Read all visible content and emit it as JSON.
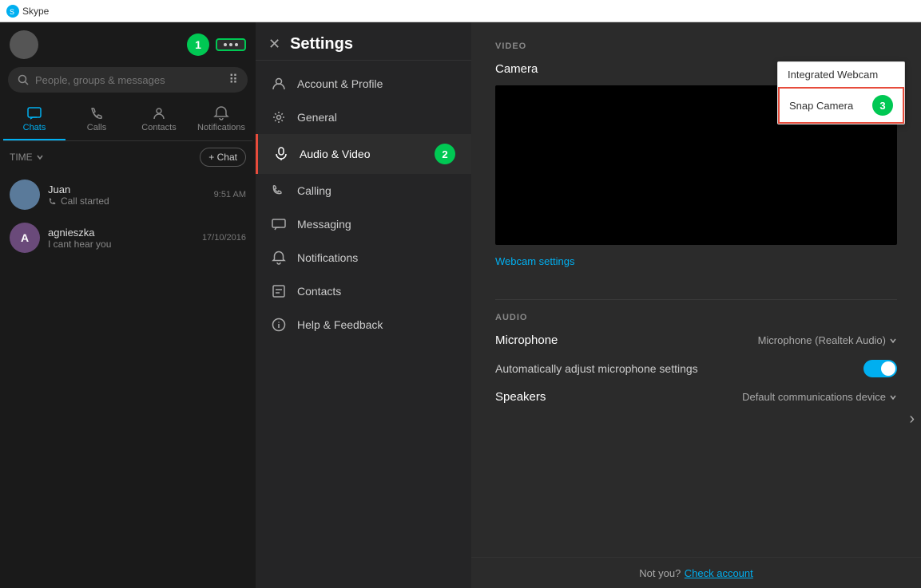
{
  "titleBar": {
    "appName": "Skype"
  },
  "sidebar": {
    "moreButtonLabel": "...",
    "searchPlaceholder": "People, groups & messages",
    "navTabs": [
      {
        "id": "chats",
        "label": "Chats",
        "active": true
      },
      {
        "id": "calls",
        "label": "Calls",
        "active": false
      },
      {
        "id": "contacts",
        "label": "Contacts",
        "active": false
      },
      {
        "id": "notifications",
        "label": "Notifications",
        "active": false
      }
    ],
    "timeLabel": "TIME",
    "newChatLabel": "+ Chat",
    "chatItems": [
      {
        "id": "juan",
        "name": "Juan",
        "preview": "Call started",
        "time": "9:51 AM",
        "hasCallIcon": true
      },
      {
        "id": "agnieszka",
        "name": "agnieszka",
        "preview": "I cant hear you",
        "time": "17/10/2016",
        "hasCallIcon": false
      }
    ],
    "stepBadge": "1"
  },
  "settingsPanel": {
    "title": "Settings",
    "menuItems": [
      {
        "id": "account",
        "label": "Account & Profile",
        "icon": "person"
      },
      {
        "id": "general",
        "label": "General",
        "icon": "gear"
      },
      {
        "id": "audio-video",
        "label": "Audio & Video",
        "icon": "mic",
        "active": true
      },
      {
        "id": "calling",
        "label": "Calling",
        "icon": "phone"
      },
      {
        "id": "messaging",
        "label": "Messaging",
        "icon": "message"
      },
      {
        "id": "notifications",
        "label": "Notifications",
        "icon": "bell"
      },
      {
        "id": "contacts",
        "label": "Contacts",
        "icon": "contacts"
      },
      {
        "id": "help",
        "label": "Help & Feedback",
        "icon": "info"
      }
    ],
    "stepBadge": "2"
  },
  "mainContent": {
    "videoSection": {
      "sectionLabel": "VIDEO",
      "cameraLabel": "Camera",
      "cameraValue": "Integrated Webcam",
      "dropdownItems": [
        {
          "id": "integrated",
          "label": "Integrated Webcam",
          "selected": true
        },
        {
          "id": "snap",
          "label": "Snap Camera",
          "highlighted": true
        }
      ],
      "webcamSettingsLink": "Webcam settings",
      "stepBadge": "3"
    },
    "audioSection": {
      "sectionLabel": "AUDIO",
      "microphoneLabel": "Microphone",
      "microphoneValue": "Microphone (Realtek Audio)",
      "autoAdjustLabel": "Automatically adjust microphone settings",
      "speakersLabel": "Speakers",
      "speakersValue": "Default communications device"
    },
    "footer": {
      "notYouText": "Not you?",
      "checkAccountText": "Check account"
    }
  }
}
